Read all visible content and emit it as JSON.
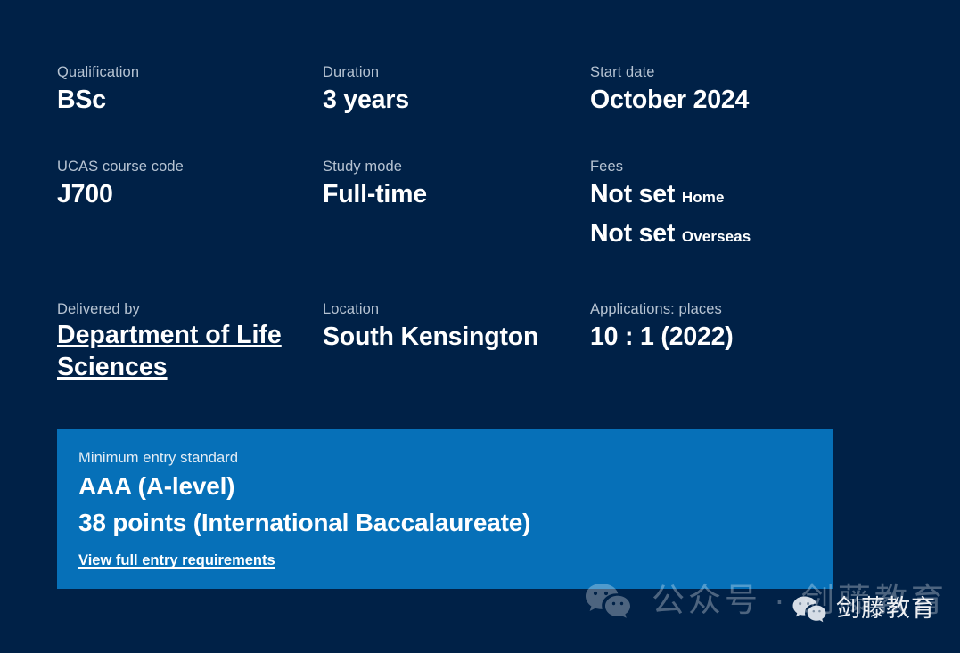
{
  "theme": {
    "background": "#002147",
    "panel_background": "#0670b8",
    "label_color": "#b6c3d2",
    "value_color": "#ffffff"
  },
  "facts": [
    {
      "label": "Qualification",
      "value": "BSc"
    },
    {
      "label": "Duration",
      "value": "3 years"
    },
    {
      "label": "Start date",
      "value": "October 2024"
    },
    {
      "label": "UCAS course code",
      "value": "J700"
    },
    {
      "label": "Study mode",
      "value": "Full-time"
    },
    {
      "label": "Fees",
      "value": "Not set",
      "qualifier": "Home",
      "value2": "Not set",
      "qualifier2": "Overseas"
    },
    {
      "label": "Delivered by",
      "value": "Department of Life Sciences",
      "is_link": true
    },
    {
      "label": "Location",
      "value": "South Kensington"
    },
    {
      "label": "Applications: places",
      "value": "10 : 1 (2022)"
    }
  ],
  "entry_standard": {
    "label": "Minimum entry standard",
    "line1": "AAA (A-level)",
    "line2": "38 points (International Baccalaureate)",
    "link_label": "View full entry requirements"
  },
  "watermark": {
    "primary_text": "公众号 · 剑藤教育",
    "secondary_text": "剑藤教育",
    "icon": "wechat-icon"
  }
}
